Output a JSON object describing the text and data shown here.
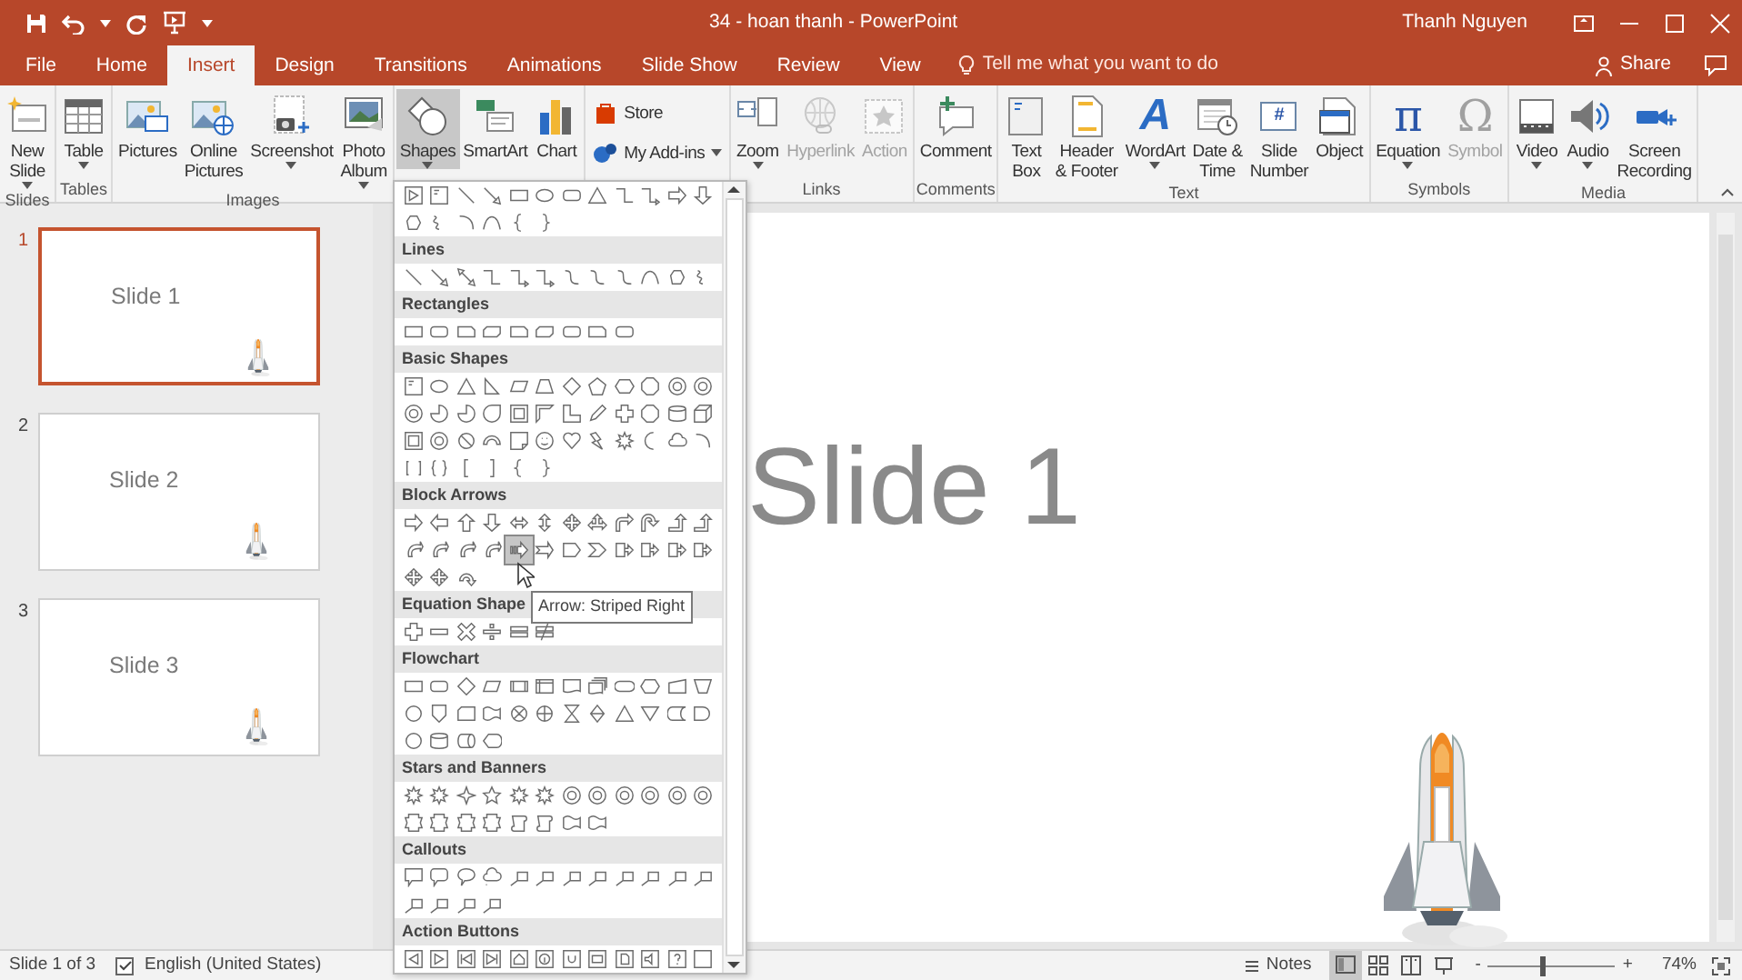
{
  "title_bar": {
    "title": "34 - hoan thanh  -  PowerPoint",
    "user": "Thanh Nguyen"
  },
  "tabs": [
    {
      "label": "File",
      "selected": false
    },
    {
      "label": "Home",
      "selected": false
    },
    {
      "label": "Insert",
      "selected": true
    },
    {
      "label": "Design",
      "selected": false
    },
    {
      "label": "Transitions",
      "selected": false
    },
    {
      "label": "Animations",
      "selected": false
    },
    {
      "label": "Slide Show",
      "selected": false
    },
    {
      "label": "Review",
      "selected": false
    },
    {
      "label": "View",
      "selected": false
    }
  ],
  "tell_me": {
    "placeholder": "Tell me what you want to do"
  },
  "share": "Share",
  "ribbon": {
    "groups": [
      {
        "label": "Slides",
        "kind": "large",
        "buttons": [
          {
            "kind": "new-slide",
            "lines": [
              "New",
              "Slide"
            ],
            "dropdown": true,
            "disabled": false,
            "selected": false
          }
        ]
      },
      {
        "label": "Tables",
        "kind": "large",
        "buttons": [
          {
            "kind": "table",
            "lines": [
              "Table"
            ],
            "dropdown": true,
            "disabled": false,
            "selected": false
          }
        ]
      },
      {
        "label": "Images",
        "kind": "large",
        "buttons": [
          {
            "kind": "pictures",
            "lines": [
              "Pictures"
            ],
            "dropdown": false,
            "disabled": false,
            "selected": false
          },
          {
            "kind": "online-pictures",
            "lines": [
              "Online",
              "Pictures"
            ],
            "dropdown": false,
            "disabled": false,
            "selected": false
          },
          {
            "kind": "screenshot",
            "lines": [
              "Screenshot"
            ],
            "dropdown": true,
            "disabled": false,
            "selected": false
          },
          {
            "kind": "photo-album",
            "lines": [
              "Photo",
              "Album"
            ],
            "dropdown": true,
            "disabled": false,
            "selected": false
          }
        ]
      },
      {
        "kind": "large",
        "buttons": [
          {
            "kind": "shapes",
            "lines": [
              "Shapes"
            ],
            "dropdown": true,
            "disabled": false,
            "selected": true
          },
          {
            "kind": "smartart",
            "lines": [
              "SmartArt"
            ],
            "dropdown": false,
            "disabled": false,
            "selected": false
          },
          {
            "kind": "chart",
            "lines": [
              "Chart"
            ],
            "dropdown": false,
            "disabled": false,
            "selected": false
          }
        ]
      },
      {
        "kind": "stacked",
        "buttons": [
          {
            "kind": "store",
            "lines": [
              "Store"
            ],
            "dropdown": false,
            "disabled": false,
            "selected": false
          },
          {
            "kind": "addins",
            "lines": [
              "My Add-ins"
            ],
            "dropdown": true,
            "disabled": false,
            "selected": false
          }
        ]
      },
      {
        "label": "Links",
        "kind": "large",
        "buttons": [
          {
            "kind": "zoom",
            "lines": [
              "Zoom"
            ],
            "dropdown": true,
            "disabled": false,
            "selected": false
          },
          {
            "kind": "hyperlink",
            "lines": [
              "Hyperlink"
            ],
            "dropdown": false,
            "disabled": true,
            "selected": false
          },
          {
            "kind": "action",
            "lines": [
              "Action"
            ],
            "dropdown": false,
            "disabled": true,
            "selected": false
          }
        ]
      },
      {
        "label": "Comments",
        "kind": "large",
        "buttons": [
          {
            "kind": "comment",
            "lines": [
              "Comment"
            ],
            "dropdown": false,
            "disabled": false,
            "selected": false
          }
        ]
      },
      {
        "label": "Text",
        "kind": "large",
        "buttons": [
          {
            "kind": "textbox",
            "lines": [
              "Text",
              "Box"
            ],
            "dropdown": false,
            "disabled": false,
            "selected": false
          },
          {
            "kind": "header-footer",
            "lines": [
              "Header",
              "& Footer"
            ],
            "dropdown": false,
            "disabled": false,
            "selected": false
          },
          {
            "kind": "wordart",
            "glyph": "A",
            "lines": [
              "WordArt"
            ],
            "dropdown": true,
            "disabled": false,
            "selected": false
          },
          {
            "kind": "date-time",
            "lines": [
              "Date &",
              "Time"
            ],
            "dropdown": false,
            "disabled": false,
            "selected": false
          },
          {
            "kind": "slide-number",
            "glyph": "#",
            "lines": [
              "Slide",
              "Number"
            ],
            "dropdown": false,
            "disabled": false,
            "selected": false
          },
          {
            "kind": "object",
            "lines": [
              "Object"
            ],
            "dropdown": false,
            "disabled": false,
            "selected": false
          }
        ]
      },
      {
        "label": "Symbols",
        "kind": "large",
        "buttons": [
          {
            "kind": "equation",
            "glyph": "π",
            "lines": [
              "Equation"
            ],
            "dropdown": true,
            "disabled": false,
            "selected": false
          },
          {
            "kind": "symbol",
            "glyph": "Ω",
            "lines": [
              "Symbol"
            ],
            "dropdown": false,
            "disabled": true,
            "selected": false
          }
        ]
      },
      {
        "label": "Media",
        "kind": "large",
        "buttons": [
          {
            "kind": "video",
            "lines": [
              "Video"
            ],
            "dropdown": true,
            "disabled": false,
            "selected": false
          },
          {
            "kind": "audio",
            "lines": [
              "Audio"
            ],
            "dropdown": true,
            "disabled": false,
            "selected": false
          },
          {
            "kind": "screen-recording",
            "lines": [
              "Screen",
              "Recording"
            ],
            "dropdown": false,
            "disabled": false,
            "selected": false
          }
        ]
      }
    ]
  },
  "thumbnails": [
    {
      "number": "1",
      "title": "Slide 1",
      "selected": true
    },
    {
      "number": "2",
      "title": "Slide 2",
      "selected": false
    },
    {
      "number": "3",
      "title": "Slide 3",
      "selected": false
    }
  ],
  "slide": {
    "title": "Slide 1"
  },
  "shapes_gallery": {
    "hovered": {
      "kind": "striped"
    },
    "tooltip": "Arrow: Striped Right",
    "sections": [
      {
        "kind": "recent"
      },
      {
        "kind": "lines",
        "title": "Lines"
      },
      {
        "kind": "rectangles",
        "title": "Rectangles"
      },
      {
        "kind": "basic",
        "title": "Basic Shapes"
      },
      {
        "kind": "block-arrows",
        "title": "Block Arrows"
      },
      {
        "kind": "equation",
        "title": "Equation Shape"
      },
      {
        "kind": "flowchart",
        "title": "Flowchart"
      },
      {
        "kind": "stars",
        "title": "Stars and Banners"
      },
      {
        "kind": "callouts",
        "title": "Callouts"
      },
      {
        "kind": "action",
        "title": "Action Buttons"
      }
    ]
  },
  "status_bar": {
    "slide_info": "Slide 1 of 3",
    "language": "English (United States)",
    "notes": "Notes",
    "views": [
      {
        "kind": "normal",
        "selected": true
      },
      {
        "kind": "sorter",
        "selected": false
      },
      {
        "kind": "reading",
        "selected": false
      },
      {
        "kind": "slideshow",
        "selected": false
      }
    ],
    "zoom_out": "-",
    "zoom_in": "+",
    "zoom": {
      "level": 0.42,
      "reading": "74%"
    }
  }
}
